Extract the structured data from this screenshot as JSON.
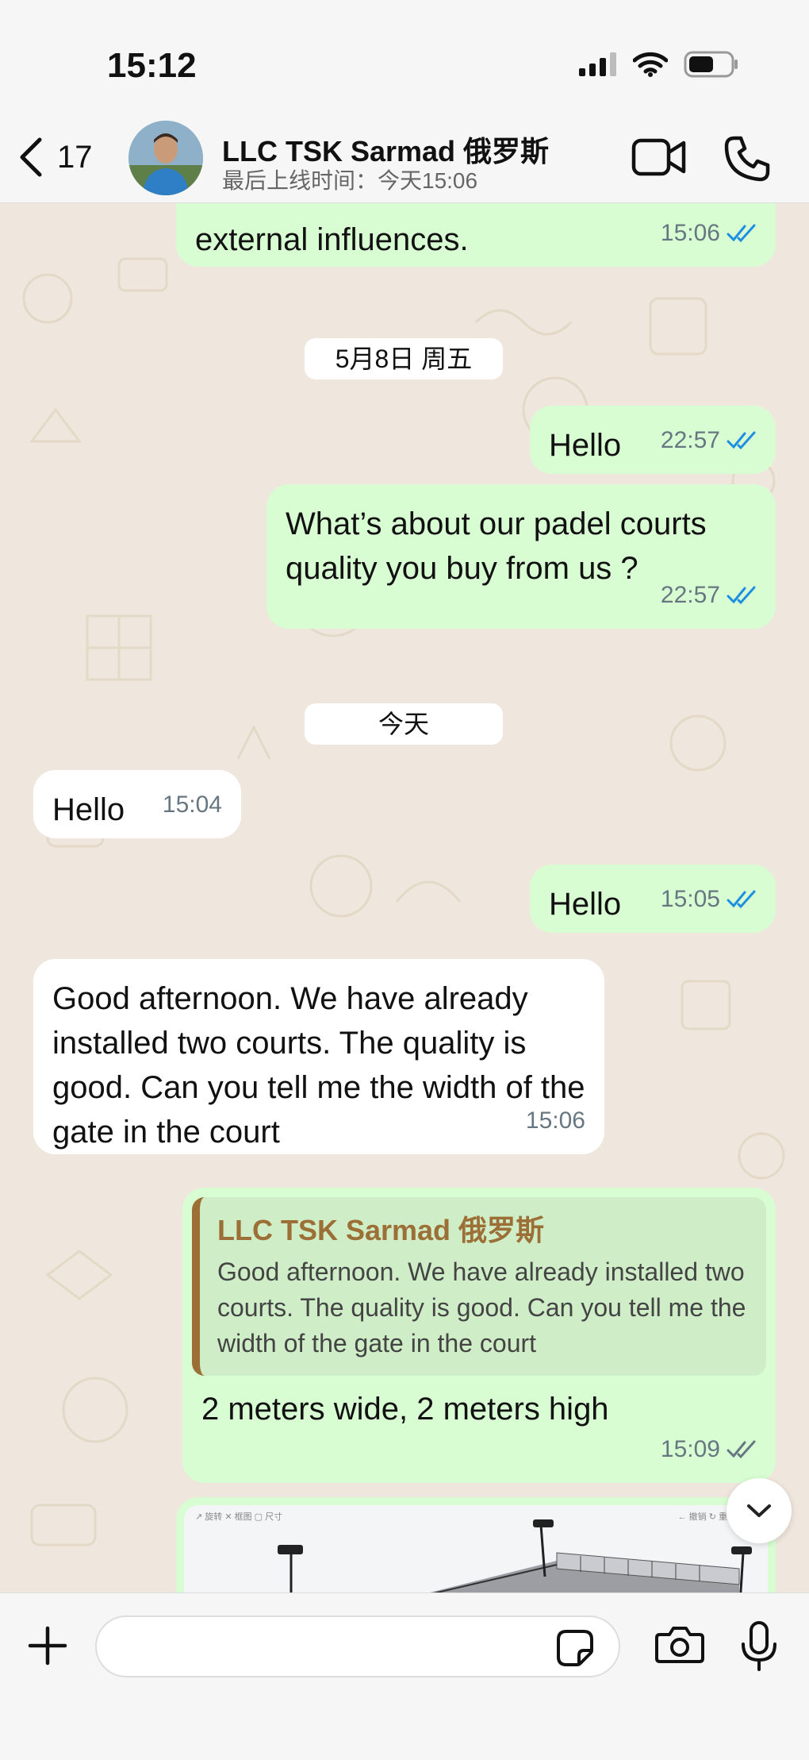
{
  "status_bar": {
    "time": "15:12"
  },
  "header": {
    "back_count": "17",
    "contact_name": "LLC TSK Sarmad 俄罗斯",
    "last_seen": "最后上线时间：今天15:06"
  },
  "messages": [
    {
      "direction": "out",
      "text": "external influences.",
      "time": "15:06",
      "ticks": "read"
    },
    {
      "type": "date",
      "text": "5月8日 周五"
    },
    {
      "direction": "out",
      "text": "Hello",
      "time": "22:57",
      "ticks": "read"
    },
    {
      "direction": "out",
      "text": "What’s about our padel courts quality you buy from us ?",
      "time": "22:57",
      "ticks": "read"
    },
    {
      "type": "date",
      "text": "今天"
    },
    {
      "direction": "in",
      "text": "Hello",
      "time": "15:04"
    },
    {
      "direction": "out",
      "text": "Hello",
      "time": "15:05",
      "ticks": "read"
    },
    {
      "direction": "in",
      "text": "Good afternoon. We have already installed two courts. The quality is good. Can you tell me the width of the gate in the court",
      "time": "15:06"
    },
    {
      "direction": "out",
      "quote": {
        "name": "LLC TSK Sarmad 俄罗斯",
        "text": "Good afternoon. We have already installed two courts. The quality is good. Can you tell me the width of the gate in the court"
      },
      "text": "2 meters wide, 2 meters high",
      "time": "15:09",
      "ticks": "delivered"
    }
  ],
  "image_preview": {
    "toolbar_left": "↗ 旋转   ✕ 框图   ▢ 尺寸",
    "toolbar_right": "← 撤销   ↻ 重做"
  },
  "input": {
    "placeholder": "",
    "value": ""
  },
  "colors": {
    "outgoing_bubble": "#d9fdd3",
    "incoming_bubble": "#ffffff",
    "read_tick": "#1d8fe1",
    "quote_accent": "#9b6f35"
  },
  "icons": [
    "signal-icon",
    "wifi-icon",
    "battery-icon",
    "chevron-left-icon",
    "video-camera-icon",
    "phone-icon",
    "chevron-down-icon",
    "plus-icon",
    "sticker-icon",
    "camera-icon",
    "microphone-icon"
  ]
}
